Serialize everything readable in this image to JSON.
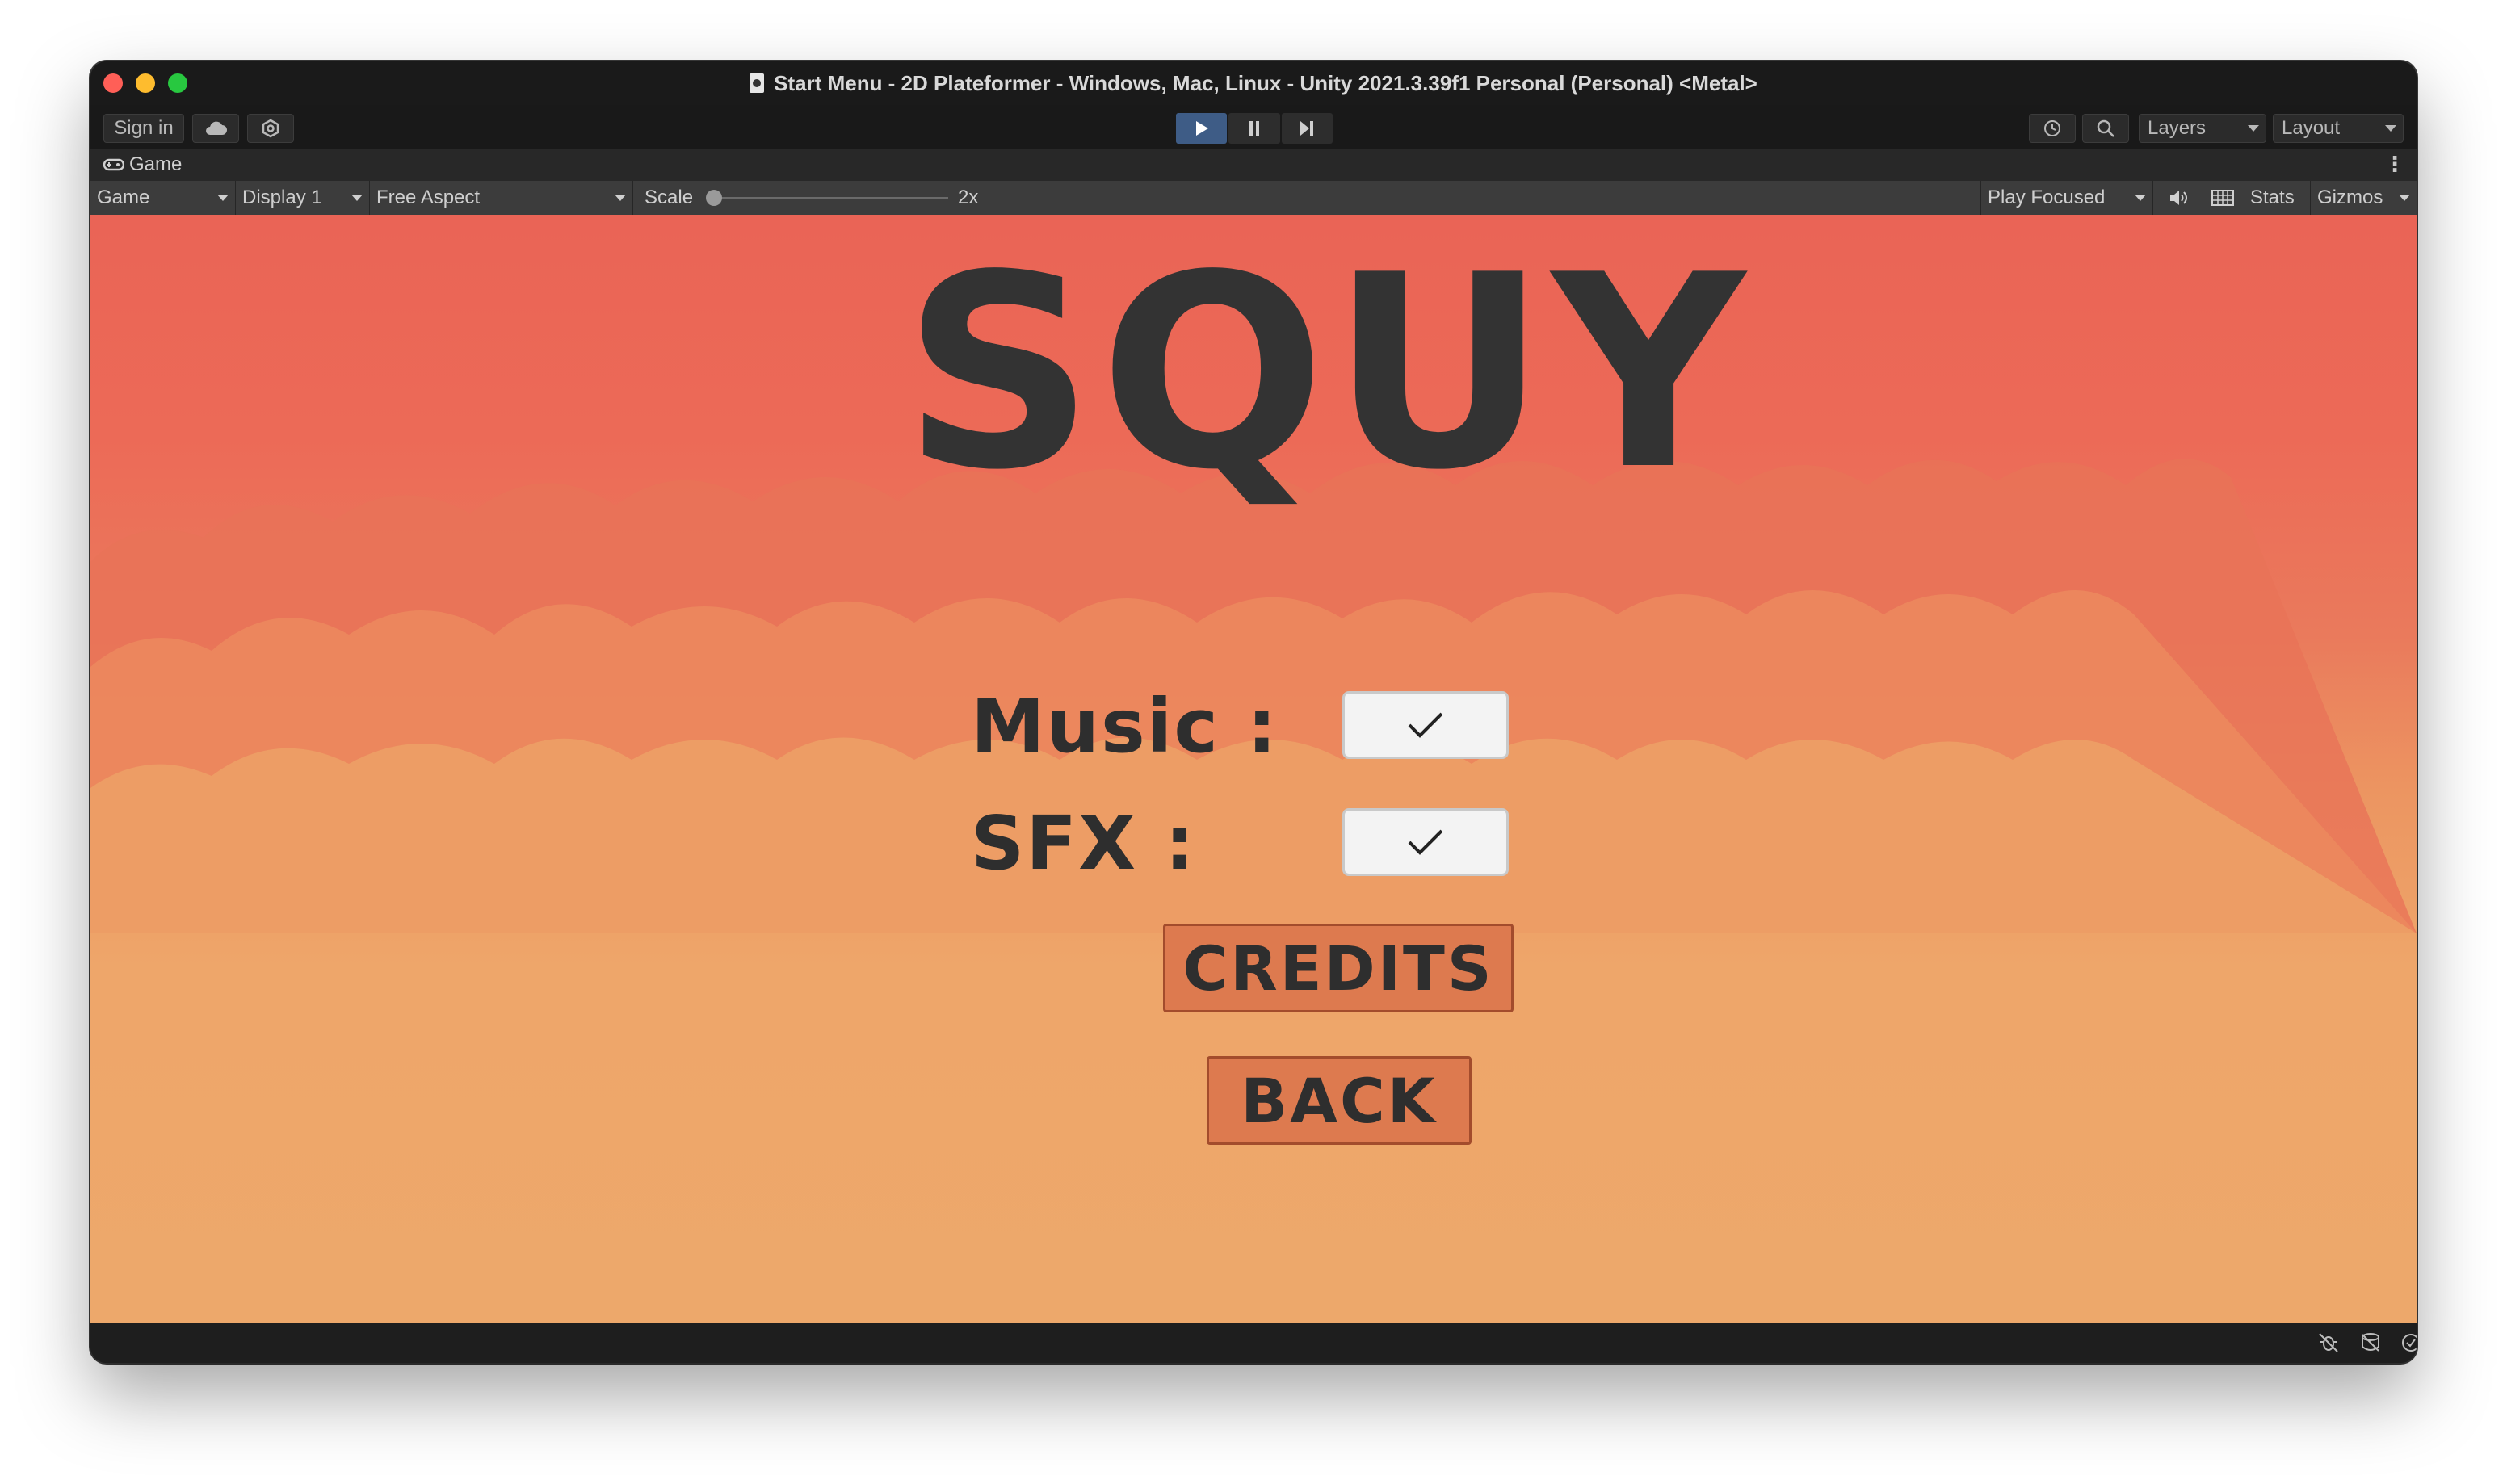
{
  "window": {
    "title": "Start Menu - 2D Plateformer - Windows, Mac, Linux - Unity 2021.3.39f1 Personal (Personal) <Metal>"
  },
  "toolbar": {
    "sign_in": "Sign in",
    "cloud_icon": "cloud-icon",
    "settings_icon": "settings-icon",
    "play_icon": "play-icon",
    "pause_icon": "pause-icon",
    "step_icon": "step-icon",
    "history_icon": "history-icon",
    "search_icon": "search-icon",
    "layers": "Layers",
    "layout": "Layout"
  },
  "tab": {
    "label": "Game"
  },
  "game_toolbar": {
    "view": "Game",
    "display": "Display 1",
    "aspect": "Free Aspect",
    "scale_label": "Scale",
    "scale_value": "2x",
    "play_mode": "Play Focused",
    "stats": "Stats",
    "gizmos": "Gizmos"
  },
  "game": {
    "logo": "SQUY",
    "music_label": "Music :",
    "music_checked": true,
    "sfx_label": "SFX :",
    "sfx_checked": true,
    "credits_button": "CREDITS",
    "back_button": "BACK"
  },
  "colors": {
    "sky_top": "#ea6456",
    "sky_bottom": "#eda86b",
    "button_fill": "#dd7a4f",
    "text_dark": "#2e2e2e",
    "play_active": "#3e5c86"
  }
}
